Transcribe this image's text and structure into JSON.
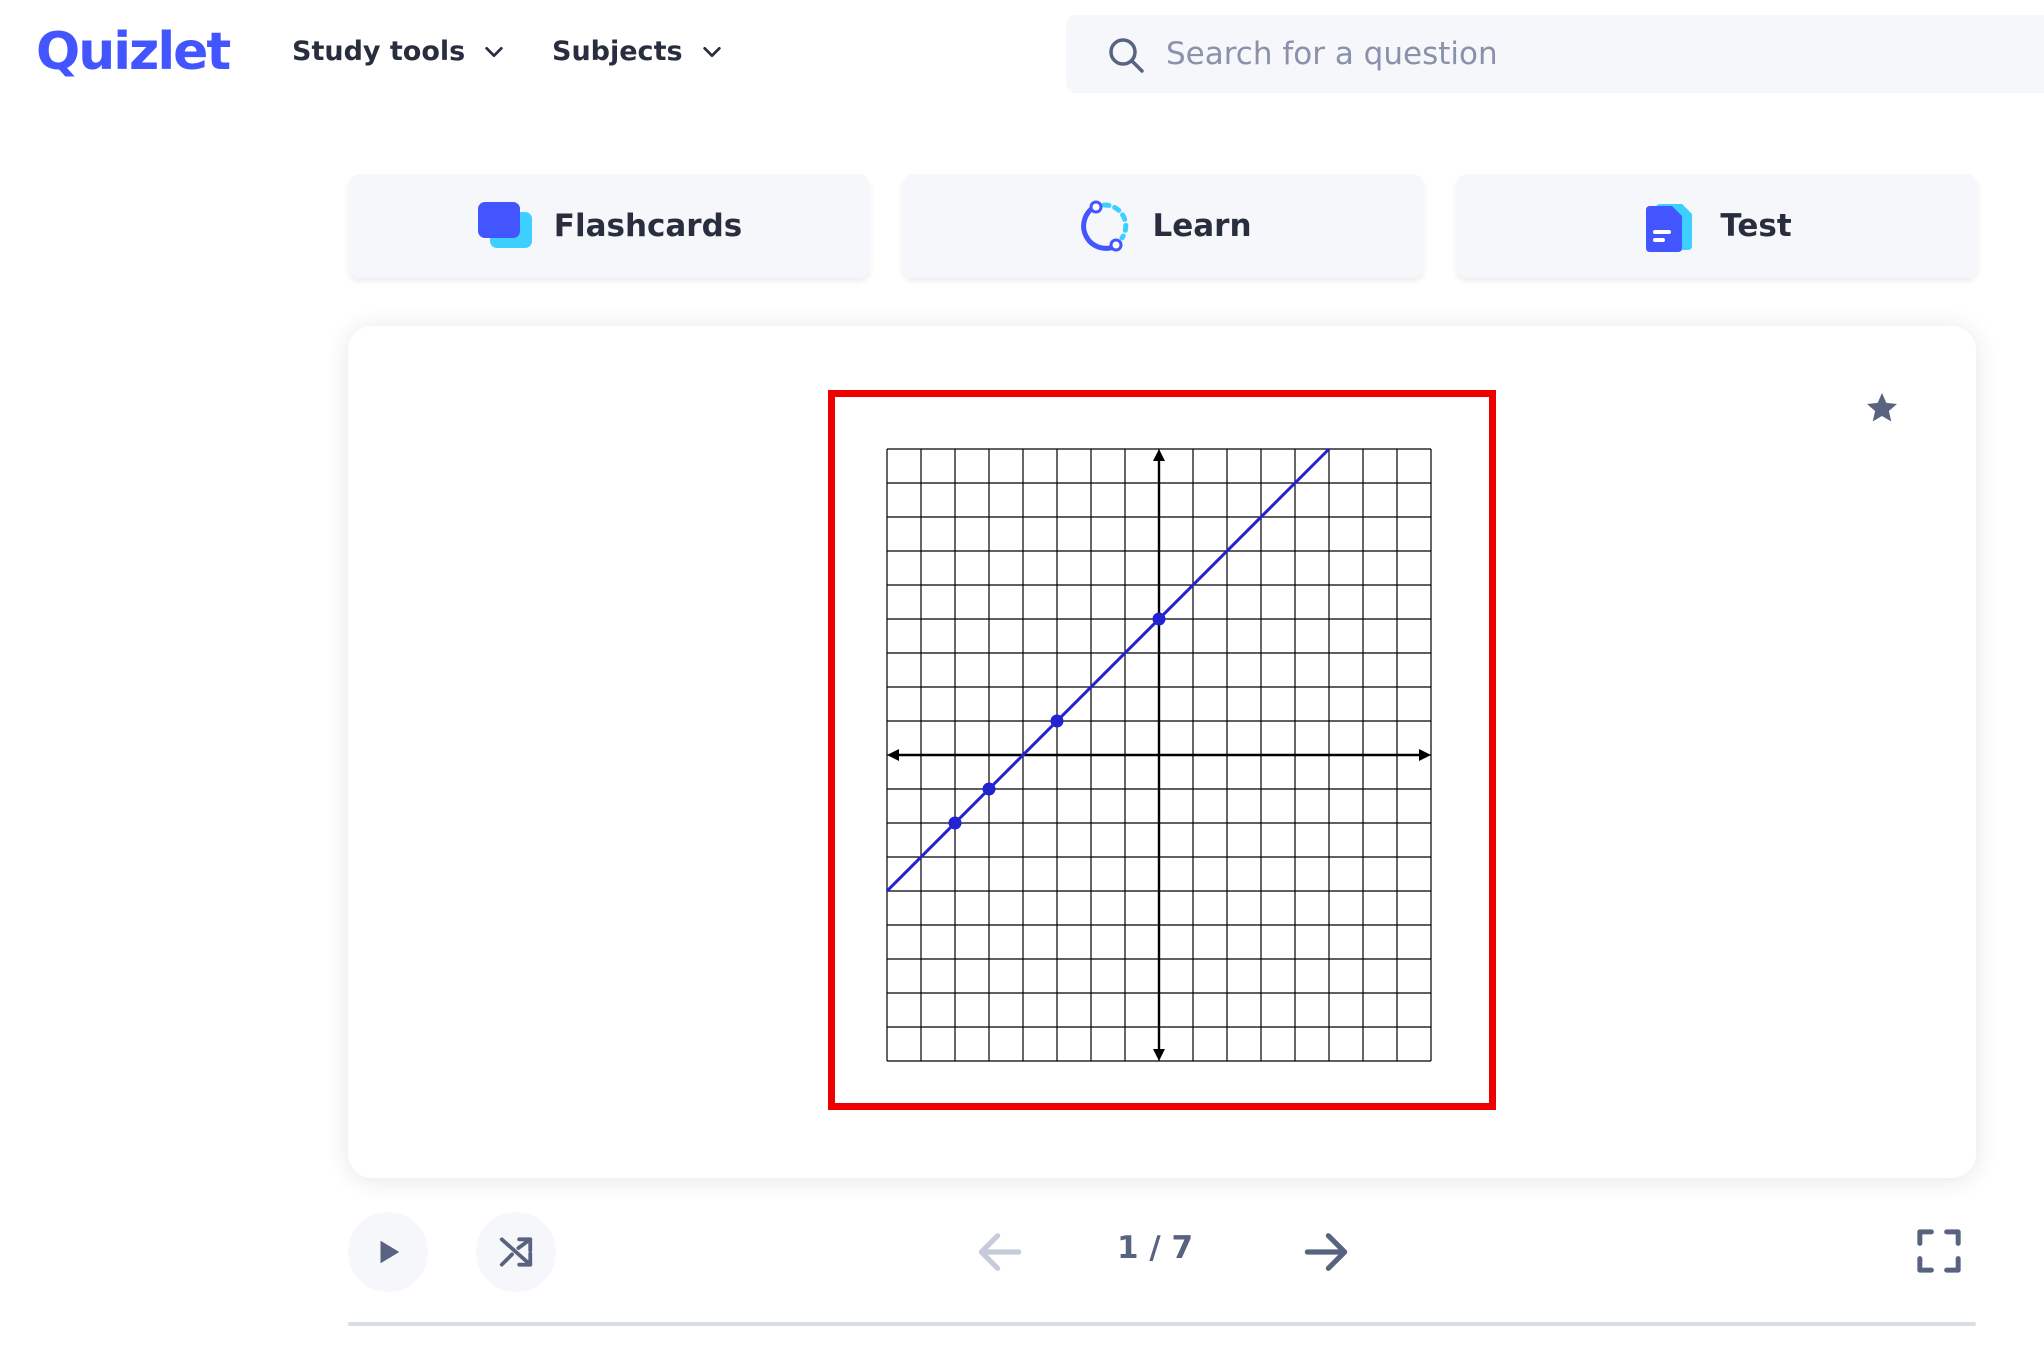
{
  "brand": {
    "logo_text": "Quizlet",
    "color": "#4255ff"
  },
  "nav": {
    "items": [
      {
        "label": "Study tools",
        "icon": "chevron-down-icon"
      },
      {
        "label": "Subjects",
        "icon": "chevron-down-icon"
      }
    ]
  },
  "search": {
    "placeholder": "Search for a question",
    "value": "",
    "icon": "search-icon"
  },
  "modes": [
    {
      "label": "Flashcards",
      "icon": "flashcards-icon"
    },
    {
      "label": "Learn",
      "icon": "learn-icon"
    },
    {
      "label": "Test",
      "icon": "test-icon"
    }
  ],
  "card": {
    "image_highlight_color": "#ee0000",
    "star_icon": "star-icon",
    "graph": {
      "type": "line",
      "grid_columns": 16,
      "grid_rows": 18,
      "line_color": "#2323d0",
      "points": [
        [
          -6,
          -2
        ],
        [
          -5,
          -1
        ],
        [
          -3,
          1
        ],
        [
          0,
          4
        ]
      ],
      "line_endpoints": [
        [
          -8,
          -4
        ],
        [
          5,
          9
        ]
      ]
    }
  },
  "controls": {
    "play_icon": "play-icon",
    "shuffle_icon": "shuffle-icon",
    "prev_icon": "arrow-left-icon",
    "next_icon": "arrow-right-icon",
    "fullscreen_icon": "fullscreen-icon",
    "counter": "1 / 7",
    "current": 1,
    "total": 7
  }
}
